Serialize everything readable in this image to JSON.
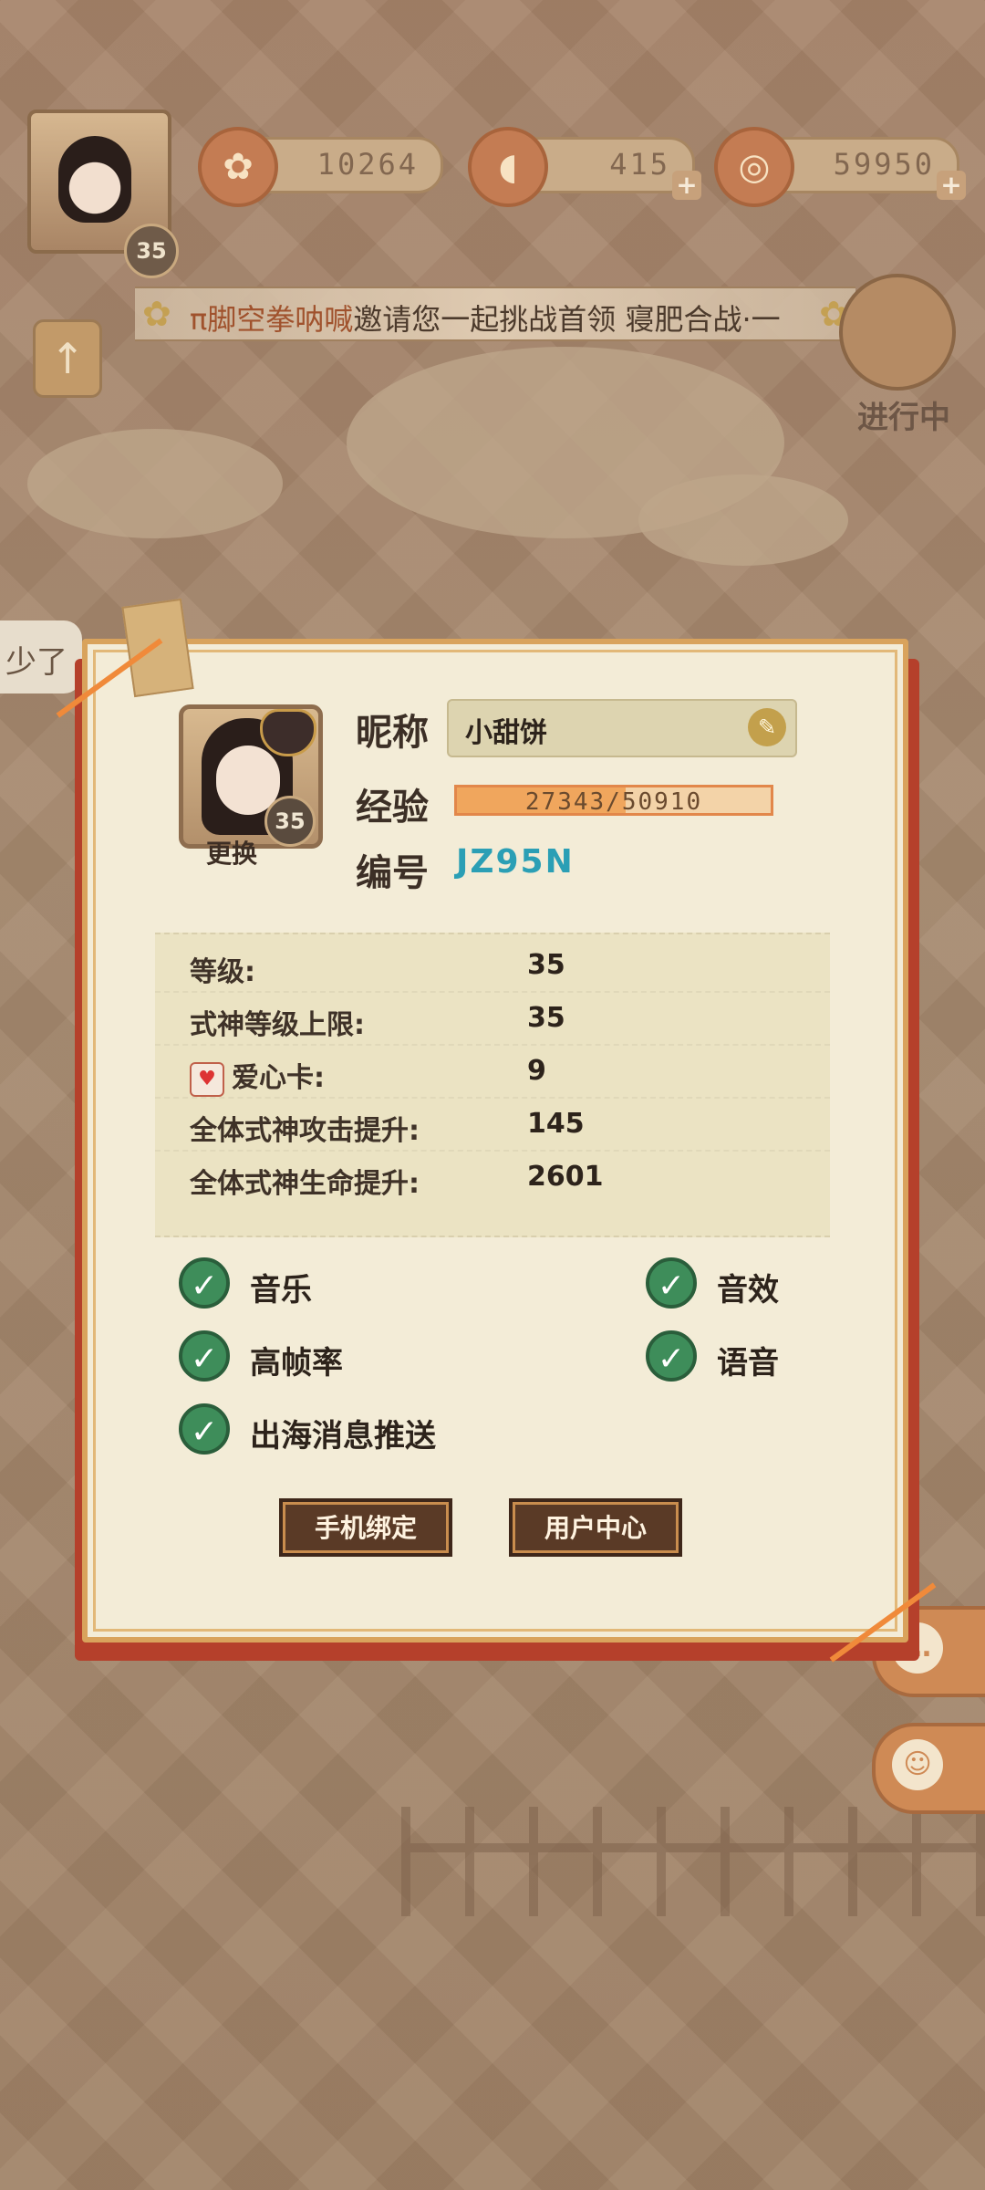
{
  "top": {
    "player_level": "35",
    "resources": [
      {
        "icon": "fan-icon",
        "value": "10264",
        "has_plus": false
      },
      {
        "icon": "magatama-icon",
        "value": "415",
        "has_plus": true
      },
      {
        "icon": "coin-icon",
        "value": "59950",
        "has_plus": true
      }
    ],
    "marquee": {
      "highlight": "π脚空拳呐喊",
      "text": "邀请您一起挑战首领 寝肥合战·一"
    },
    "boss_label": "进行中",
    "side_text": "少了"
  },
  "profile": {
    "portrait_level": "35",
    "change_label": "更换",
    "nickname_label": "昵称",
    "nickname": "小甜饼",
    "exp_label": "经验",
    "exp_value": "27343/50910",
    "exp_current": 27343,
    "exp_max": 50910,
    "id_label": "编号",
    "id_value": "JZ95N"
  },
  "stats": [
    {
      "label": "等级:",
      "value": "35"
    },
    {
      "label": "式神等级上限:",
      "value": "35"
    },
    {
      "label": "爱心卡:",
      "value": "9",
      "icon": "heart-card-icon"
    },
    {
      "label": "全体式神攻击提升:",
      "value": "145"
    },
    {
      "label": "全体式神生命提升:",
      "value": "2601"
    }
  ],
  "settings": {
    "music": {
      "label": "音乐",
      "checked": true
    },
    "sfx": {
      "label": "音效",
      "checked": true
    },
    "high_fps": {
      "label": "高帧率",
      "checked": true
    },
    "voice": {
      "label": "语音",
      "checked": true
    },
    "push": {
      "label": "出海消息推送",
      "checked": true
    }
  },
  "buttons": {
    "bind_phone": "手机绑定",
    "user_center": "用户中心"
  }
}
